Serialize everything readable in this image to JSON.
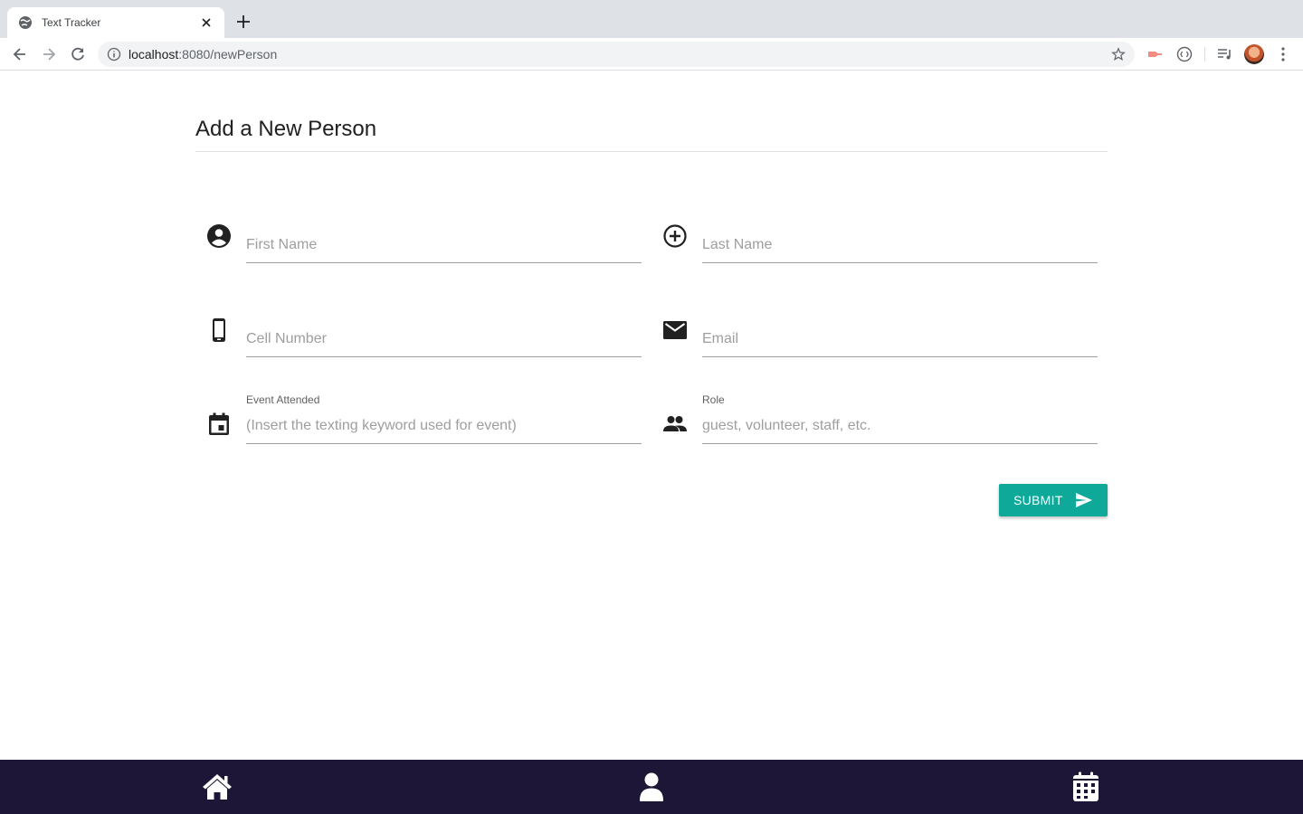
{
  "browser": {
    "tab_title": "Text Tracker",
    "url_host": "localhost",
    "url_rest": ":8080/newPerson"
  },
  "page": {
    "title": "Add a New Person"
  },
  "form": {
    "first_name": {
      "label": "",
      "placeholder": "First Name",
      "value": ""
    },
    "last_name": {
      "label": "",
      "placeholder": "Last Name",
      "value": ""
    },
    "cell_number": {
      "label": "",
      "placeholder": "Cell Number",
      "value": ""
    },
    "email": {
      "label": "",
      "placeholder": "Email",
      "value": ""
    },
    "event_attended": {
      "label": "Event Attended",
      "placeholder": "(Insert the texting keyword used for event)",
      "value": ""
    },
    "role": {
      "label": "Role",
      "placeholder": "guest, volunteer, staff, etc.",
      "value": ""
    },
    "submit_label": "SUBMIT"
  },
  "icons": {
    "first_name": "account-circle-icon",
    "last_name": "add-circle-icon",
    "cell_number": "smartphone-icon",
    "email": "mail-icon",
    "event_attended": "event-icon",
    "role": "people-icon",
    "submit": "send-icon"
  },
  "bottom_nav": {
    "items": [
      "home-icon",
      "person-icon",
      "calendar-icon"
    ]
  },
  "colors": {
    "accent": "#0fa99a",
    "bottom_nav_bg": "#1d1636"
  }
}
